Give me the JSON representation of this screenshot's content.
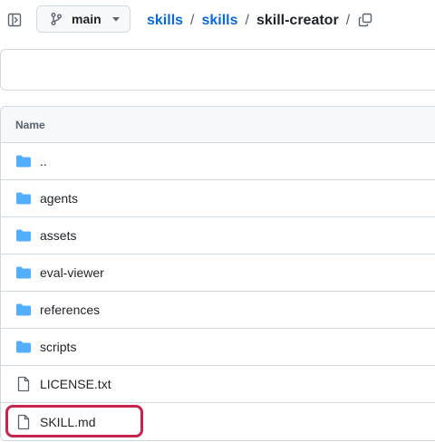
{
  "toolbar": {
    "branch": "main",
    "sidebar_icon": "sidebar-expand-icon",
    "branch_icon": "git-branch-icon",
    "caret_icon": "triangle-down-icon",
    "copy_icon": "copy-icon"
  },
  "breadcrumb": {
    "items": [
      "skills",
      "skills"
    ],
    "separator": "/",
    "current": "skill-creator",
    "trailing_separator": "/"
  },
  "table": {
    "header": "Name",
    "rows": [
      {
        "name": "..",
        "type": "folder",
        "icon": "folder-icon"
      },
      {
        "name": "agents",
        "type": "folder",
        "icon": "folder-icon"
      },
      {
        "name": "assets",
        "type": "folder",
        "icon": "folder-icon"
      },
      {
        "name": "eval-viewer",
        "type": "folder",
        "icon": "folder-icon"
      },
      {
        "name": "references",
        "type": "folder",
        "icon": "folder-icon"
      },
      {
        "name": "scripts",
        "type": "folder",
        "icon": "folder-icon"
      },
      {
        "name": "LICENSE.txt",
        "type": "file",
        "icon": "file-icon"
      },
      {
        "name": "SKILL.md",
        "type": "file",
        "icon": "file-icon"
      }
    ]
  },
  "colors": {
    "link": "#0969da",
    "folder": "#54aeff",
    "highlight": "#c7254e",
    "border": "#d1d9e0"
  }
}
